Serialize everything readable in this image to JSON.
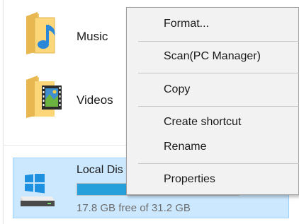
{
  "explorer": {
    "folders": [
      {
        "label": "Music",
        "icon": "music-folder-icon"
      },
      {
        "label": "Videos",
        "icon": "videos-folder-icon"
      }
    ],
    "drive": {
      "name": "Local Dis",
      "free_text": "17.8 GB free of 31.2 GB",
      "used_fraction": 0.43,
      "icon": "windows-drive-icon"
    },
    "colors": {
      "selection_bg": "#cce8ff",
      "selection_border": "#99d1ff",
      "bar_fill": "#26a0da"
    }
  },
  "context_menu": {
    "items": [
      {
        "label": "Format..."
      },
      {
        "label": "Scan(PC Manager)"
      },
      {
        "label": "Copy"
      },
      {
        "label": "Create shortcut"
      },
      {
        "label": "Rename"
      },
      {
        "label": "Properties"
      }
    ],
    "colors": {
      "background": "#f2f2f2",
      "border": "#a0a0a0"
    }
  }
}
